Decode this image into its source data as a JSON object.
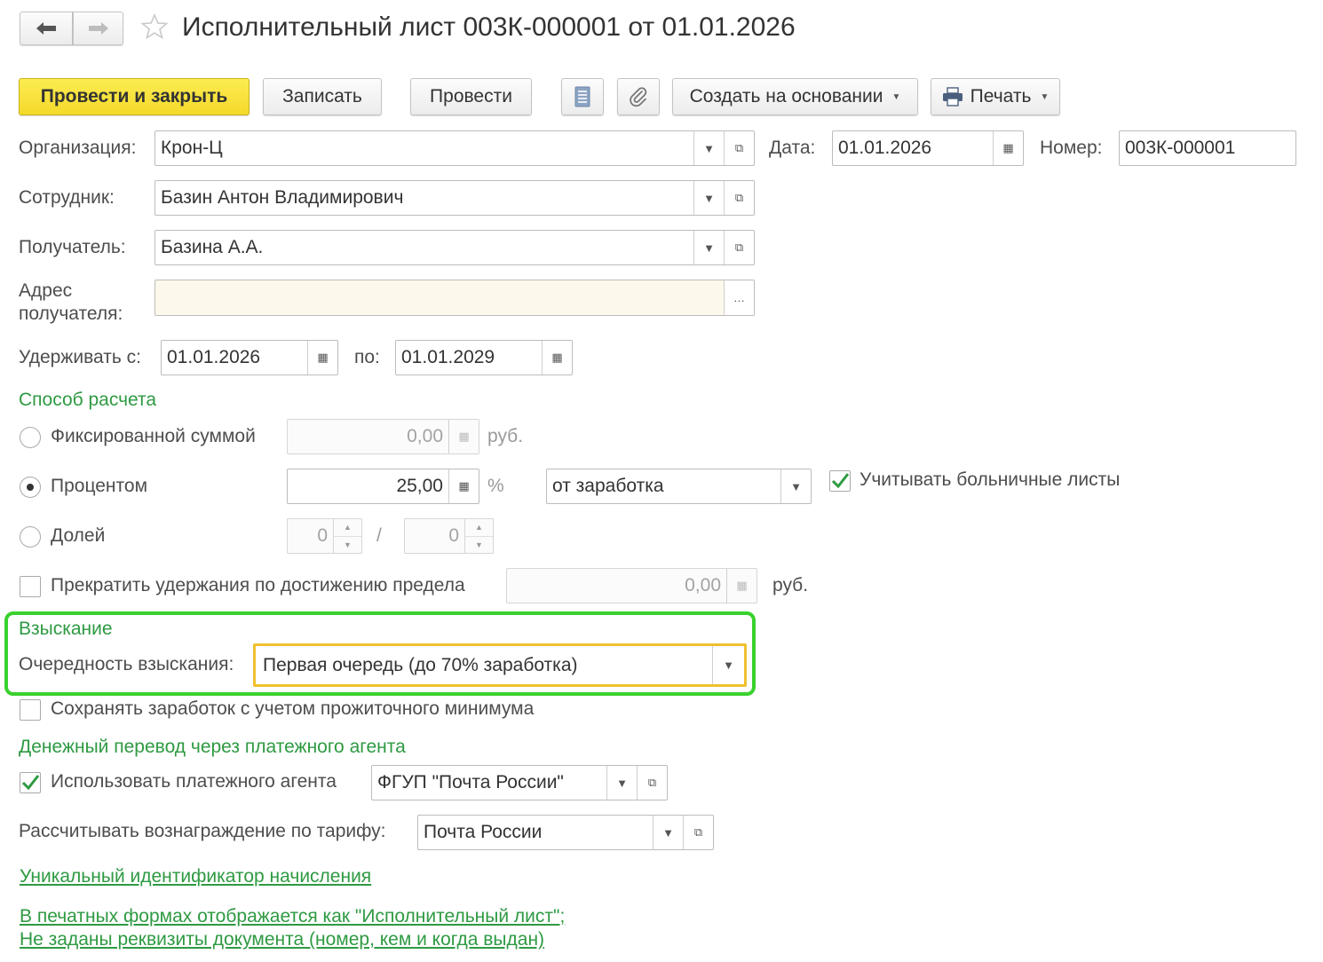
{
  "header": {
    "title": "Исполнительный лист 003К-000001 от 01.01.2026"
  },
  "toolbar": {
    "post_close": "Провести и закрыть",
    "save": "Записать",
    "post": "Провести",
    "create_based_on": "Создать на основании",
    "print": "Печать"
  },
  "fields": {
    "organization_label": "Организация:",
    "organization": "Крон-Ц",
    "date_label": "Дата:",
    "date": "01.01.2026",
    "number_label": "Номер:",
    "number": "003К-000001",
    "employee_label": "Сотрудник:",
    "employee": "Базин Антон Владимирович",
    "recipient_label": "Получатель:",
    "recipient": "Базина А.А.",
    "address_label_1": "Адрес",
    "address_label_2": "получателя:",
    "address": "",
    "withhold_from_label": "Удерживать с:",
    "withhold_from": "01.01.2026",
    "withhold_to_label": "по:",
    "withhold_to": "01.01.2029"
  },
  "calc": {
    "section_title": "Способ расчета",
    "fixed_label": "Фиксированной суммой",
    "fixed_value": "0,00",
    "fixed_unit": "руб.",
    "percent_label": "Процентом",
    "percent_value": "25,00",
    "percent_unit": "%",
    "percent_base": "от заработка",
    "sick_leave_label": "Учитывать больничные листы",
    "sick_leave_checked": true,
    "share_label": "Долей",
    "share_num": "0",
    "share_sep": "/",
    "share_den": "0",
    "selected": "percent",
    "limit_label": "Прекратить удержания по достижению предела",
    "limit_value": "0,00",
    "limit_unit": "руб.",
    "limit_checked": false
  },
  "collection": {
    "section_title": "Взыскание",
    "order_label": "Очередность взыскания:",
    "order_value": "Первая очередь (до 70% заработка)",
    "highlight_color": "#39d12e",
    "field_border_color": "#f0c030"
  },
  "keep_min_label": "Сохранять заработок с учетом прожиточного минимума",
  "keep_min_checked": false,
  "transfer": {
    "section_title": "Денежный перевод через платежного агента",
    "use_agent_label": "Использовать платежного агента",
    "use_agent_checked": true,
    "agent": "ФГУП \"Почта России\"",
    "tariff_label": "Рассчитывать вознаграждение по тарифу:",
    "tariff": "Почта России"
  },
  "links": {
    "uid": "Уникальный идентификатор начисления",
    "print_forms_1": "В печатных формах отображается как \"Исполнительный лист\";",
    "print_forms_2": "Не заданы реквизиты документа (номер, кем и когда выдан)"
  }
}
